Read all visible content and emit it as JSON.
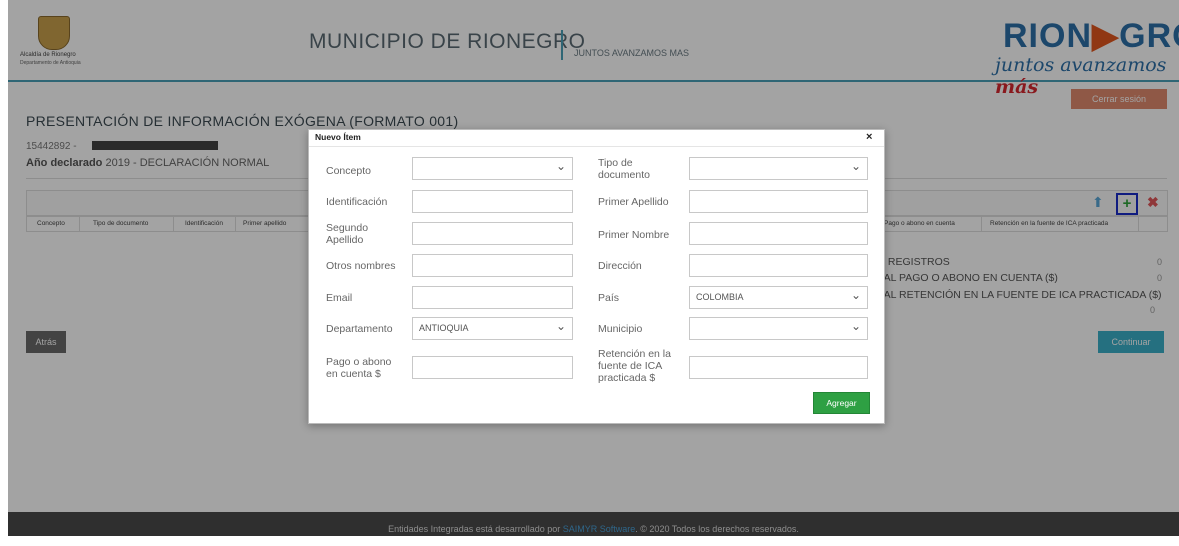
{
  "header": {
    "crest_caption_1": "Alcaldía de Rionegro",
    "crest_caption_2": "Departamento de Antioquia",
    "title": "MUNICIPIO DE RIONEGRO",
    "slogan": "JUNTOS AVANZAMOS MAS",
    "logo_main_left": "RION",
    "logo_main_arrow": "▶",
    "logo_main_right": "GRO",
    "logo_sub": "juntos avanzamos ",
    "logo_sub_accent": "más"
  },
  "page": {
    "logout_label": "Cerrar sesión",
    "title": "PRESENTACIÓN DE INFORMACIÓN EXÓGENA (FORMATO 001)",
    "nit_prefix": "15442892 - ",
    "year_label": "Año declarado",
    "year_value": "2019 - DECLARACIÓN NORMAL"
  },
  "table": {
    "columns_left": [
      "Concepto",
      "Tipo de documento",
      "Identificación",
      "Primer apellido"
    ],
    "columns_right": [
      "Pago o abono en cuenta",
      "Retención en la fuente de ICA practicada"
    ]
  },
  "summary": {
    "registros_label": "E REGISTROS",
    "registros_value": "0",
    "pago_label": "TAL PAGO O ABONO EN CUENTA ($)",
    "pago_value": "0",
    "retencion_label": "TAL RETENCIÓN EN LA FUENTE DE ICA PRACTICADA ($)",
    "retencion_value": "0"
  },
  "buttons": {
    "back": "Atrás",
    "continue": "Continuar"
  },
  "footer": {
    "prefix": "Entidades Integradas está desarrollado por ",
    "link": "SAIMYR Software",
    "suffix": ". © 2020 Todos los derechos reservados."
  },
  "modal": {
    "title": "Nuevo Ítem",
    "close": "×",
    "concepto_label": "Concepto",
    "concepto_value": "",
    "tipo_documento_label_1": "Tipo de",
    "tipo_documento_label_2": "documento",
    "tipo_documento_value": "",
    "identificacion_label": "Identificación",
    "identificacion_value": "",
    "primer_apellido_label": "Primer Apellido",
    "primer_apellido_value": "",
    "segundo_apellido_label_1": "Segundo",
    "segundo_apellido_label_2": "Apellido",
    "segundo_apellido_value": "",
    "primer_nombre_label": "Primer Nombre",
    "primer_nombre_value": "",
    "otros_nombres_label": "Otros nombres",
    "otros_nombres_value": "",
    "direccion_label": "Dirección",
    "direccion_value": "",
    "email_label": "Email",
    "email_value": "",
    "pais_label": "País",
    "pais_value": "COLOMBIA",
    "departamento_label": "Departamento",
    "departamento_value": "ANTIOQUIA",
    "municipio_label": "Municipio",
    "municipio_value": "",
    "pago_label_1": "Pago o abono",
    "pago_label_2": "en cuenta $",
    "pago_value": "",
    "retencion_label_1": "Retención en la",
    "retencion_label_2": "fuente de ICA",
    "retencion_label_3": "practicada $",
    "retencion_value": "",
    "add_label": "Agregar"
  },
  "icons": {
    "move_up": "⬆",
    "add": "+",
    "delete": "✖"
  }
}
